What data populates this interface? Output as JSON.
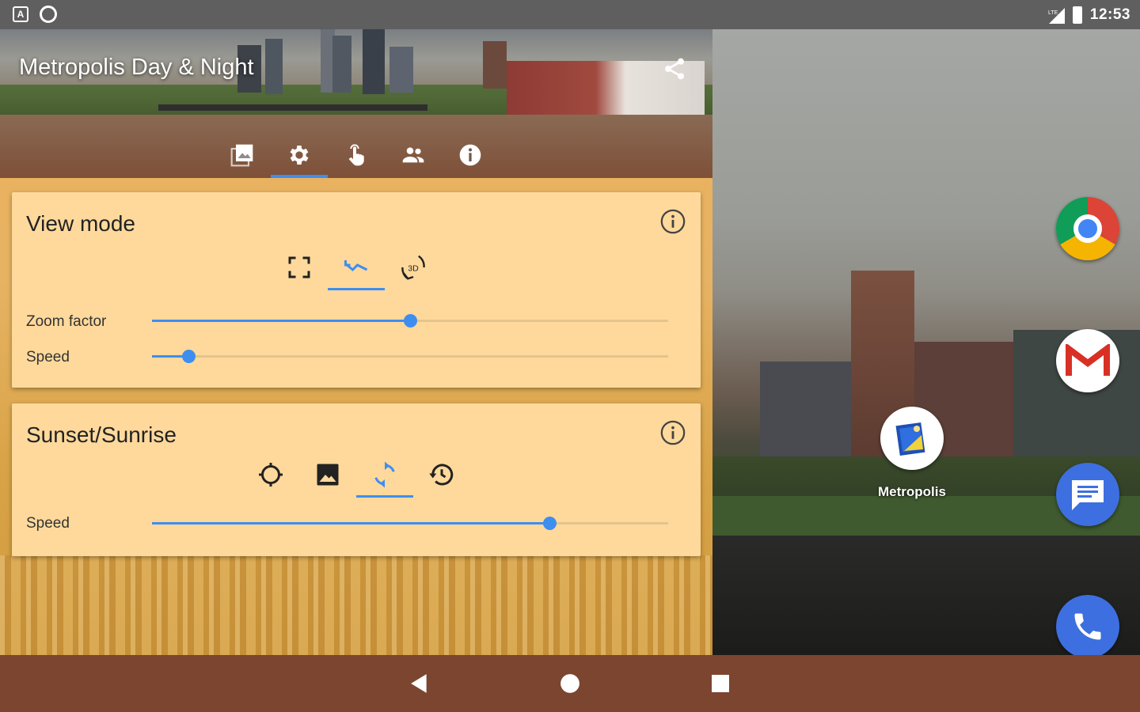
{
  "status_bar": {
    "time": "12:53",
    "left_badge": "A",
    "network": "LTE"
  },
  "app": {
    "title": "Metropolis Day & Night",
    "tabs": [
      {
        "name": "wallpaper-tab",
        "icon": "gallery-icon",
        "active": false
      },
      {
        "name": "settings-tab",
        "icon": "gear-icon",
        "active": true
      },
      {
        "name": "touch-tab",
        "icon": "touch-icon",
        "active": false
      },
      {
        "name": "people-tab",
        "icon": "people-icon",
        "active": false
      },
      {
        "name": "info-tab",
        "icon": "info-icon",
        "active": false
      }
    ],
    "view_mode": {
      "title": "View mode",
      "modes": [
        "fullscreen-icon",
        "pan-icon",
        "rotate-3d-icon"
      ],
      "active_mode": "pan-icon",
      "rotate_3d_label": "3D",
      "zoom_label": "Zoom factor",
      "zoom_value": 0.5,
      "speed_label": "Speed",
      "speed_value": 0.07
    },
    "sunset_sunrise": {
      "title": "Sunset/Sunrise",
      "modes": [
        "location-icon",
        "image-icon",
        "sync-icon",
        "history-icon"
      ],
      "active_mode": "sync-icon",
      "speed_label": "Speed",
      "speed_value": 0.77
    }
  },
  "home": {
    "shortcut_label": "Metropolis",
    "dock": [
      "chrome-icon",
      "gmail-icon",
      "messages-icon",
      "phone-icon"
    ]
  },
  "nav": {
    "buttons": [
      "back-icon",
      "home-icon",
      "recents-icon"
    ]
  },
  "colors": {
    "accent": "#3e8ef0",
    "card": "#ffd99b",
    "nav_bar": "#7b4530",
    "status_bar": "#5f5f5f"
  }
}
